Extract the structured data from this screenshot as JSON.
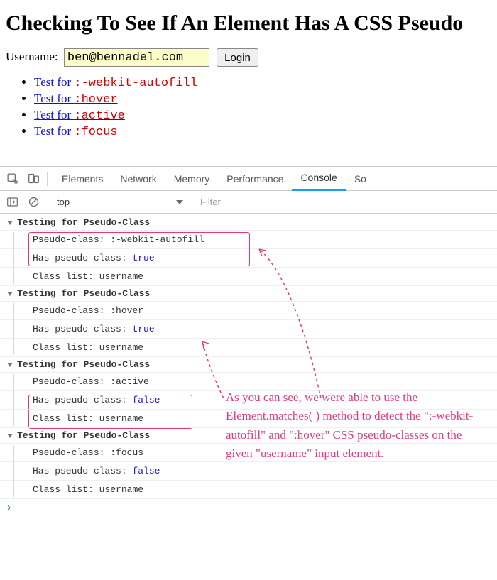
{
  "page": {
    "heading": "Checking To See If An Element Has A CSS Pseudo"
  },
  "form": {
    "label": "Username:",
    "username_value": "ben@bennadel.com",
    "login_label": "Login"
  },
  "tests": [
    {
      "prefix": "Test for ",
      "pseudo": ":-webkit-autofill"
    },
    {
      "prefix": "Test for ",
      "pseudo": ":hover"
    },
    {
      "prefix": "Test for ",
      "pseudo": ":active"
    },
    {
      "prefix": "Test for ",
      "pseudo": ":focus"
    }
  ],
  "devtools": {
    "tabs": [
      "Elements",
      "Network",
      "Memory",
      "Performance",
      "Console",
      "So"
    ],
    "active_tab": "Console",
    "context": "top",
    "filter_placeholder": "Filter"
  },
  "console": {
    "group_label": "Testing for Pseudo-Class",
    "groups": [
      {
        "lines": [
          {
            "label": "Pseudo-class:",
            "value": ":-webkit-autofill",
            "kind": "text"
          },
          {
            "label": "Has pseudo-class:",
            "value": "true",
            "kind": "bool"
          },
          {
            "label": "Class list:",
            "value": "username",
            "kind": "text"
          }
        ]
      },
      {
        "lines": [
          {
            "label": "Pseudo-class:",
            "value": ":hover",
            "kind": "text"
          },
          {
            "label": "Has pseudo-class:",
            "value": "true",
            "kind": "bool"
          },
          {
            "label": "Class list:",
            "value": "username",
            "kind": "text"
          }
        ]
      },
      {
        "lines": [
          {
            "label": "Pseudo-class:",
            "value": ":active",
            "kind": "text"
          },
          {
            "label": "Has pseudo-class:",
            "value": "false",
            "kind": "bool"
          },
          {
            "label": "Class list:",
            "value": "username",
            "kind": "text"
          }
        ]
      },
      {
        "lines": [
          {
            "label": "Pseudo-class:",
            "value": ":focus",
            "kind": "text"
          },
          {
            "label": "Has pseudo-class:",
            "value": "false",
            "kind": "bool"
          },
          {
            "label": "Class list:",
            "value": "username",
            "kind": "text"
          }
        ]
      }
    ]
  },
  "annotation": {
    "text": "As you can see, we were able to use the Element.matches( ) method to detect the \":-webkit-autofill\" and \":hover\" CSS pseudo-classes on the given \"username\" input element."
  }
}
